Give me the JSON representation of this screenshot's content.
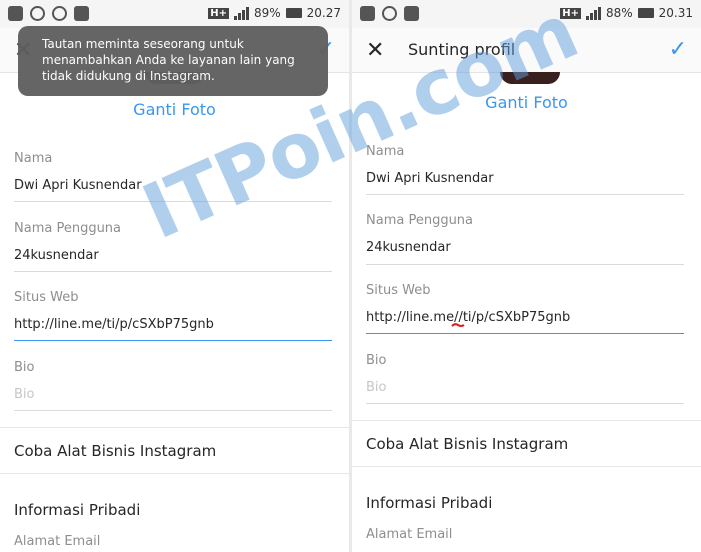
{
  "left": {
    "status": {
      "network": "H+",
      "battery": "89%",
      "time": "20.27"
    },
    "toast": "Tautan meminta seseorang untuk menambahkan Anda ke layanan lain yang tidak didukung di Instagram.",
    "change_photo": "Ganti Foto",
    "fields": {
      "name_label": "Nama",
      "name_value": "Dwi Apri Kusnendar",
      "username_label": "Nama Pengguna",
      "username_value": "24kusnendar",
      "website_label": "Situs Web",
      "website_value": "http://line.me/ti/p/cSXbP75gnb",
      "bio_label": "Bio",
      "bio_placeholder": "Bio"
    },
    "business": "Coba Alat Bisnis Instagram",
    "personal_info": "Informasi Pribadi",
    "email_label": "Alamat Email"
  },
  "right": {
    "status": {
      "network": "H+",
      "battery": "88%",
      "time": "20.31"
    },
    "title": "Sunting profil",
    "change_photo": "Ganti Foto",
    "fields": {
      "name_label": "Nama",
      "name_value": "Dwi Apri Kusnendar",
      "username_label": "Nama Pengguna",
      "username_value": "24kusnendar",
      "website_label": "Situs Web",
      "website_value": "http://line.me//ti/p/cSXbP75gnb",
      "bio_label": "Bio",
      "bio_placeholder": "Bio"
    },
    "business": "Coba Alat Bisnis Instagram",
    "personal_info": "Informasi Pribadi",
    "email_label": "Alamat Email"
  },
  "watermark": "ITPoin.com",
  "colors": {
    "accent": "#3897f0",
    "toast_bg": "#5f5f5f",
    "watermark": "#62a0dd",
    "annotation": "#e01b1b"
  }
}
